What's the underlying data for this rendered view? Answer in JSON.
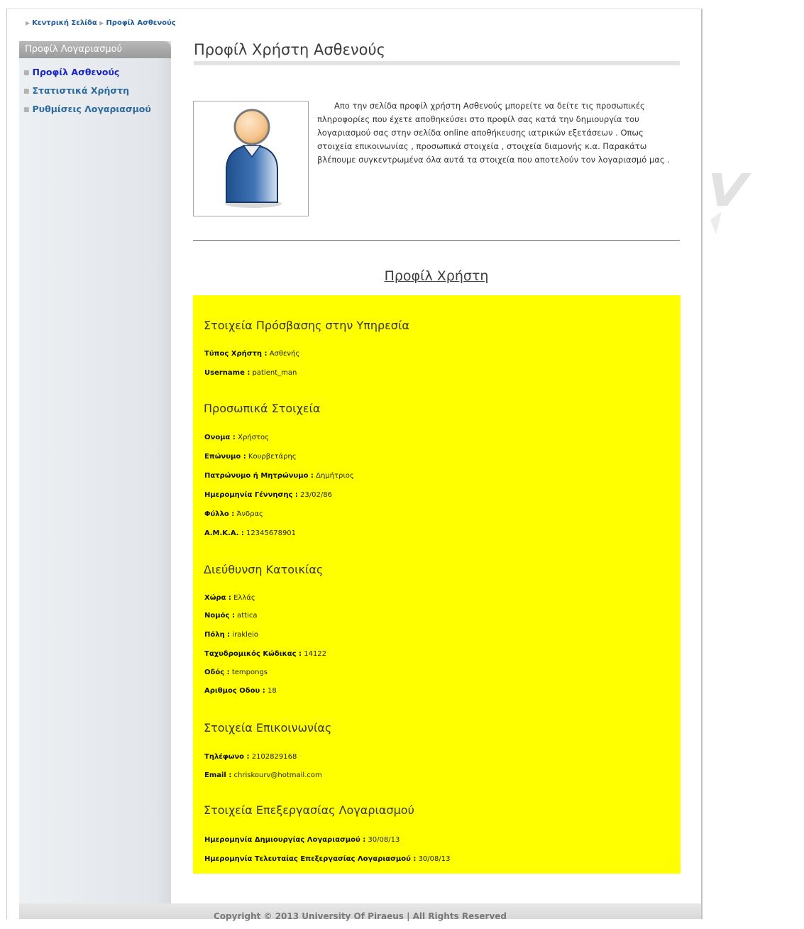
{
  "breadcrumb": {
    "home": "Κεντρική Σελίδα",
    "current": "Προφίλ Ασθενούς"
  },
  "sidebar": {
    "title": "Προφίλ Λογαριασμού",
    "items": [
      {
        "label": "Προφίλ Ασθενούς",
        "active": true
      },
      {
        "label": "Στατιστικά Χρήστη",
        "active": false
      },
      {
        "label": "Ρυθμίσεις Λογαριασμού",
        "active": false
      }
    ]
  },
  "main": {
    "title": "Προφίλ Χρήστη Ασθενούς",
    "intro": "Απο την σελίδα προφίλ χρήστη Ασθενούς μπορείτε να δείτε τις προσωπικές πληροφορίες που έχετε αποθηκεύσει στο προφίλ σας κατά την δημιουργία του λογαριασμού σας στην σελίδα online αποθήκευσης ιατρικών εξετάσεων . Οπως στοιχεία επικοινωνίας , προσωπικά στοιχεία , στοιχεία διαμονής κ.α. Παρακάτω βλέπουμε συγκεντρωμένα όλα αυτά τα στοιχεία που αποτελούν τον λογαριασμό μας .",
    "profile_heading": "Προφίλ Χρήστη"
  },
  "profile": {
    "access": {
      "title": "Στοιχεία Πρόσβασης στην Υπηρεσία",
      "user_type_label": "Τύπος Χρήστη :",
      "user_type": "Ασθενής",
      "username_label": "Username :",
      "username": "patient_man"
    },
    "personal": {
      "title": "Προσωπικά Στοιχεία",
      "first_name_label": "Ονομα :",
      "first_name": "Χρήστος",
      "last_name_label": "Επώνυμο :",
      "last_name": "Κουρβετάρης",
      "parent_name_label": "Πατρώνυμο ή Μητρώνυμο :",
      "parent_name": "Δημήτριος",
      "birth_date_label": "Ημερομηνία Γέννησης :",
      "birth_date": "23/02/86",
      "gender_label": "Φύλλο :",
      "gender": "Άνδρας",
      "amka_label": "Α.Μ.Κ.Α. :",
      "amka": "12345678901"
    },
    "address": {
      "title": "Διεύθυνση Κατοικίας",
      "country_label": "Χώρα :",
      "country": "Ελλάς",
      "prefecture_label": "Νομός :",
      "prefecture": "attica",
      "city_label": "Πόλη :",
      "city": "irakleio",
      "postal_code_label": "Ταχυδρομικός Κώδικας :",
      "postal_code": "14122",
      "street_label": "Οδός :",
      "street": "tempongs",
      "street_number_label": "Αριθμος Οδου :",
      "street_number": "18"
    },
    "contact": {
      "title": "Στοιχεία Επικοινωνίας",
      "phone_label": "Τηλέφωνο :",
      "phone": "2102829168",
      "email_label": "Email :",
      "email": "chriskourv@hotmail.com"
    },
    "account": {
      "title": "Στοιχεία Επεξεργασίας Λογαριασμού",
      "created_label": "Ημερομηνία Δημιουργίας Λογαριασμού :",
      "created": "30/08/13",
      "modified_label": "Ημερομηνία Τελευταίας Επεξεργασίας Λογαριασμού :",
      "modified": "30/08/13"
    }
  },
  "footer": {
    "text": "Copyright © 2013 University Of Piraeus | All Rights Reserved"
  },
  "colors": {
    "profile_background": "#ffff00",
    "link": "#2c6b9f",
    "active_link": "#1b25c4"
  }
}
